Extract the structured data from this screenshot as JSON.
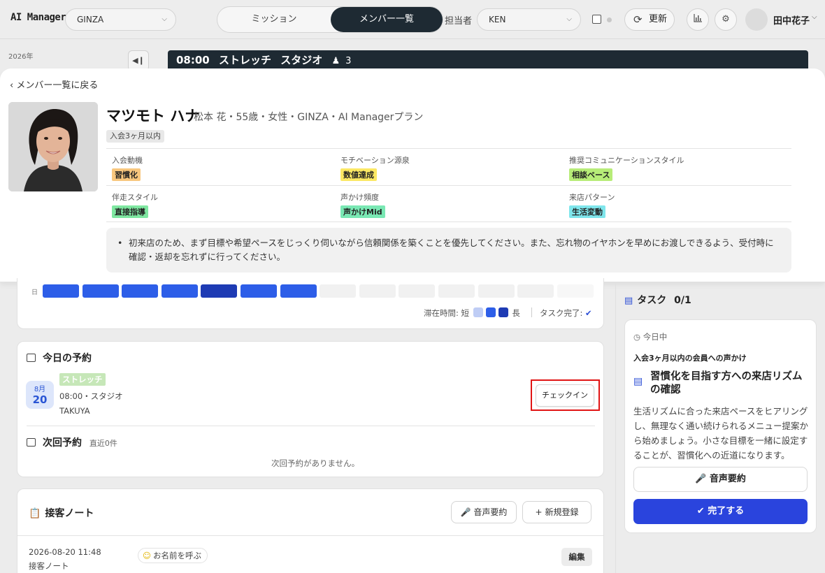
{
  "app": {
    "logo": "AI Manager"
  },
  "topbar": {
    "store": "GINZA",
    "tabs": [
      {
        "label": "ミッション"
      },
      {
        "label": "メンバー一覧"
      }
    ],
    "assignee_label": "担当者",
    "assignee": "KEN",
    "refresh_label": "更新",
    "user_name": "田中花子"
  },
  "background": {
    "year": "2026年",
    "session": {
      "time": "08:00",
      "program": "ストレッチ",
      "room": "スタジオ",
      "count": "3"
    }
  },
  "member": {
    "back_label": "メンバー一覧に戻る",
    "name": "マツモト ハナ",
    "subtitle": "松本 花・55歳・女性・GINZA・AI Managerプラン",
    "badge": "入会3ヶ月以内",
    "attributes": [
      {
        "key": "入会動機",
        "value": "習慣化",
        "color": "#f8c77e"
      },
      {
        "key": "モチベーション源泉",
        "value": "数値達成",
        "color": "#fbe864"
      },
      {
        "key": "推奨コミュニケーションスタイル",
        "value": "相談ベース",
        "color": "#b7ec78"
      },
      {
        "key": "伴走スタイル",
        "value": "直接指導",
        "color": "#7fe7a1"
      },
      {
        "key": "声かけ頻度",
        "value": "声かけMid",
        "color": "#7ae8b4"
      },
      {
        "key": "来店パターン",
        "value": "生活変動",
        "color": "#7fe6ec"
      }
    ],
    "note": "初来店のため、まず目標や希望ペースをじっくり伺いながら信頼関係を築くことを優先してください。また、忘れ物のイヤホンを早めにお渡しできるよう、受付時に確認・返却を忘れずに行ってください。"
  },
  "visits": {
    "row_label": "日",
    "bars": [
      {
        "level": "mid",
        "color": "#2d5ee8"
      },
      {
        "level": "mid",
        "color": "#2d5ee8"
      },
      {
        "level": "mid",
        "color": "#2d5ee8"
      },
      {
        "level": "mid",
        "color": "#2d5ee8"
      },
      {
        "level": "long",
        "color": "#1e3bb4"
      },
      {
        "level": "mid",
        "color": "#2d5ee8"
      },
      {
        "level": "mid",
        "color": "#2d5ee8"
      },
      {
        "level": "none",
        "color": "#f1f1f1"
      },
      {
        "level": "none",
        "color": "#f1f1f1"
      },
      {
        "level": "none",
        "color": "#f1f1f1"
      },
      {
        "level": "none",
        "color": "#f1f1f1"
      },
      {
        "level": "none",
        "color": "#f1f1f1"
      },
      {
        "level": "none",
        "color": "#f1f1f1"
      },
      {
        "level": "none",
        "color": "#f7f7f7"
      }
    ],
    "legend_prefix": "滞在時間: 短",
    "legend_suffix": "長",
    "task_done_label": "タスク完了:"
  },
  "reservations": {
    "today_title": "今日の予約",
    "month": "8月",
    "day": "20",
    "program_tag": "ストレッチ",
    "time_place": "08:00・スタジオ",
    "trainer": "TAKUYA",
    "checkin_label": "チェックイン",
    "next_title": "次回予約",
    "next_count": "直近0件",
    "next_empty": "次回予約がありません。"
  },
  "notes": {
    "title": "接客ノート",
    "voice_label": "音声要約",
    "new_label": "新規登録",
    "entry": {
      "datetime": "2026-08-20 11:48",
      "type": "接客ノート",
      "tag": "お名前を呼ぶ",
      "edit_label": "編集"
    }
  },
  "tasks": {
    "title": "タスク",
    "count": "0/1",
    "today_label": "今日中",
    "sub": "入会3ヶ月以内の会員への声かけ",
    "heading": "習慣化を目指す方への来店リズムの確認",
    "body": "生活リズムに合った来店ペースをヒアリングし、無理なく通い続けられるメニュー提案から始めましょう。小さな目標を一緒に設定することが、習慣化への近道になります。",
    "voice_label": "音声要約",
    "done_label": "完了する"
  }
}
